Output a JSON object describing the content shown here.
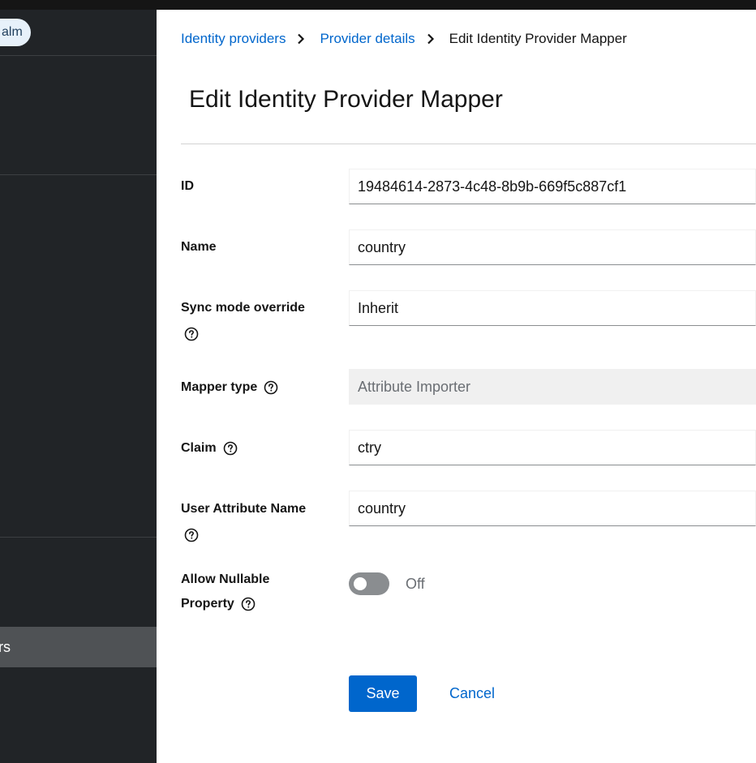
{
  "sidebar": {
    "realm_label": "alm",
    "active_item_label": "rs"
  },
  "breadcrumb": {
    "items": [
      "Identity providers",
      "Provider details"
    ],
    "current": "Edit Identity Provider Mapper"
  },
  "page": {
    "title": "Edit Identity Provider Mapper"
  },
  "form": {
    "id": {
      "label": "ID",
      "value": "19484614-2873-4c48-8b9b-669f5c887cf1"
    },
    "name": {
      "label": "Name",
      "value": "country"
    },
    "sync_mode": {
      "label": "Sync mode override",
      "value": "Inherit"
    },
    "mapper_type": {
      "label": "Mapper type",
      "value": "Attribute Importer"
    },
    "claim": {
      "label": "Claim",
      "value": "ctry"
    },
    "user_attribute": {
      "label": "User Attribute Name",
      "value": "country"
    },
    "allow_nullable": {
      "label_line1": "Allow Nullable",
      "label_line2": "Property",
      "state_text": "Off",
      "enabled": false
    }
  },
  "actions": {
    "save_label": "Save",
    "cancel_label": "Cancel"
  },
  "colors": {
    "sidebar_bg": "#212427",
    "accent": "#0066cc",
    "toggle_off": "#8a8d90"
  },
  "icons": {
    "help": "help-circle-icon",
    "separator": "chevron-right-icon"
  }
}
